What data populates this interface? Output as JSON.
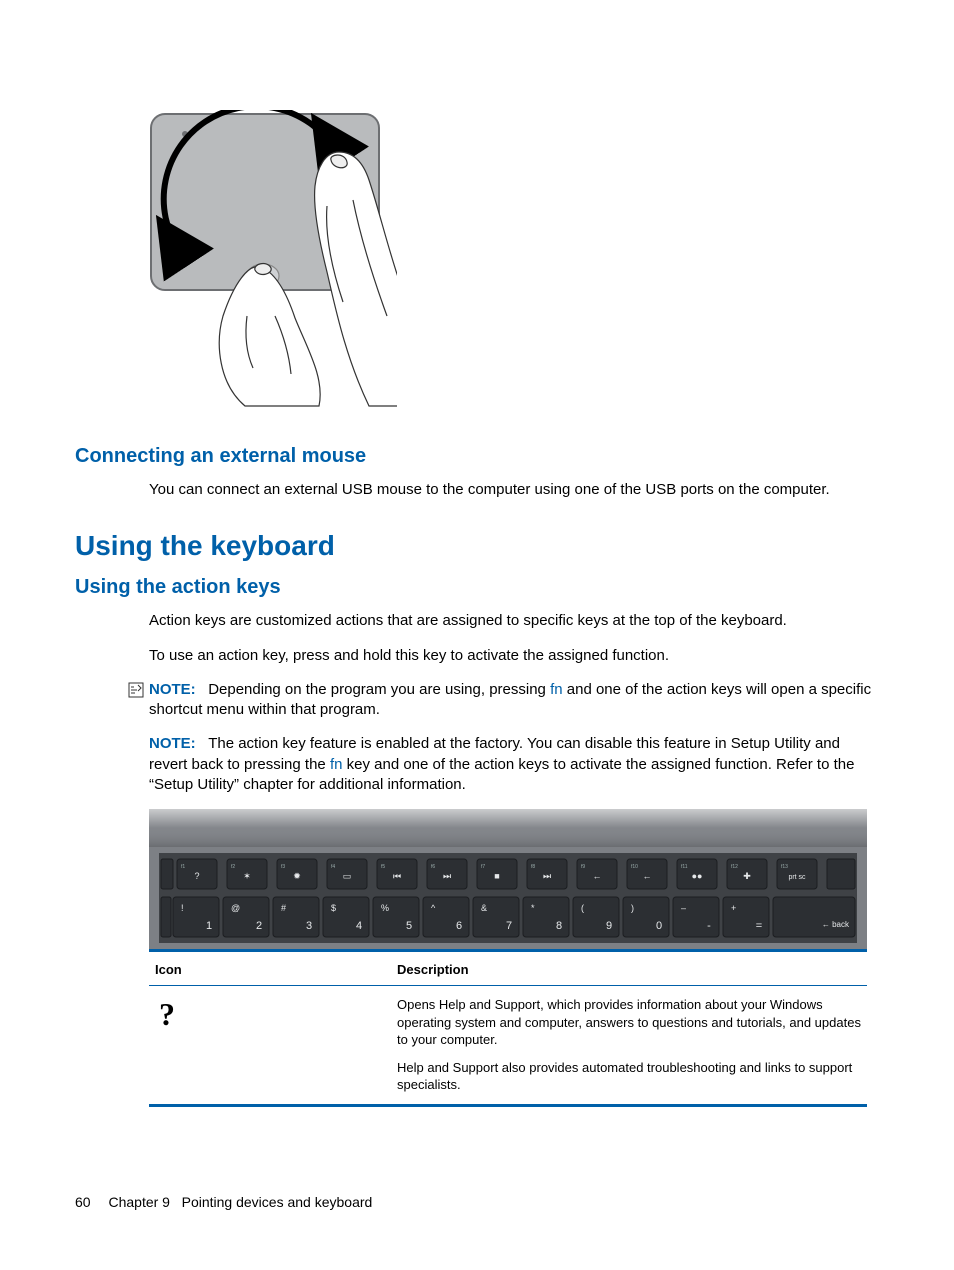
{
  "sections": {
    "connecting_heading": "Connecting an external mouse",
    "connecting_body": "You can connect an external USB mouse to the computer using one of the USB ports on the computer.",
    "keyboard_heading": "Using the keyboard",
    "action_keys_heading": "Using the action keys",
    "action_keys_p1": "Action keys are customized actions that are assigned to specific keys at the top of the keyboard.",
    "action_keys_p2": "To use an action key, press and hold this key to activate the assigned function."
  },
  "notes": {
    "label": "NOTE:",
    "note1_before": "Depending on the program you are using, pressing ",
    "note1_fn": "fn",
    "note1_after": " and one of the action keys will open a specific shortcut menu within that program.",
    "note2_before": "The action key feature is enabled at the factory. You can disable this feature in Setup Utility and revert back to pressing the ",
    "note2_fn": "fn",
    "note2_after": " key and one of the action keys to activate the assigned function. Refer to the “Setup Utility” chapter for additional information."
  },
  "keyboard_keys": {
    "action_row": [
      {
        "icon": "?"
      },
      {
        "icon": "✶"
      },
      {
        "icon": "✹"
      },
      {
        "icon": "▭"
      },
      {
        "icon": "⏮"
      },
      {
        "icon": "⏭"
      },
      {
        "icon": "■"
      },
      {
        "icon": "⏭"
      },
      {
        "icon": "←"
      },
      {
        "icon": "←"
      },
      {
        "icon": "●●"
      },
      {
        "icon": "✚"
      },
      {
        "icon": "prt sc"
      }
    ],
    "number_row": [
      {
        "sym": "!",
        "num": "1"
      },
      {
        "sym": "@",
        "num": "2"
      },
      {
        "sym": "#",
        "num": "3"
      },
      {
        "sym": "$",
        "num": "4"
      },
      {
        "sym": "%",
        "num": "5"
      },
      {
        "sym": "^",
        "num": "6"
      },
      {
        "sym": "&",
        "num": "7"
      },
      {
        "sym": "*",
        "num": "8"
      },
      {
        "sym": "(",
        "num": "9"
      },
      {
        "sym": ")",
        "num": "0"
      },
      {
        "sym": "–",
        "num": "-"
      },
      {
        "sym": "+",
        "num": "="
      }
    ],
    "back_label": "← back"
  },
  "table": {
    "header_icon": "Icon",
    "header_desc": "Description",
    "row1_icon_glyph": "?",
    "row1_p1": "Opens Help and Support, which provides information about your Windows operating system and computer, answers to questions and tutorials, and updates to your computer.",
    "row1_p2": "Help and Support also provides automated troubleshooting and links to support specialists."
  },
  "footer": {
    "page_number": "60",
    "chapter": "Chapter 9   Pointing devices and keyboard"
  }
}
